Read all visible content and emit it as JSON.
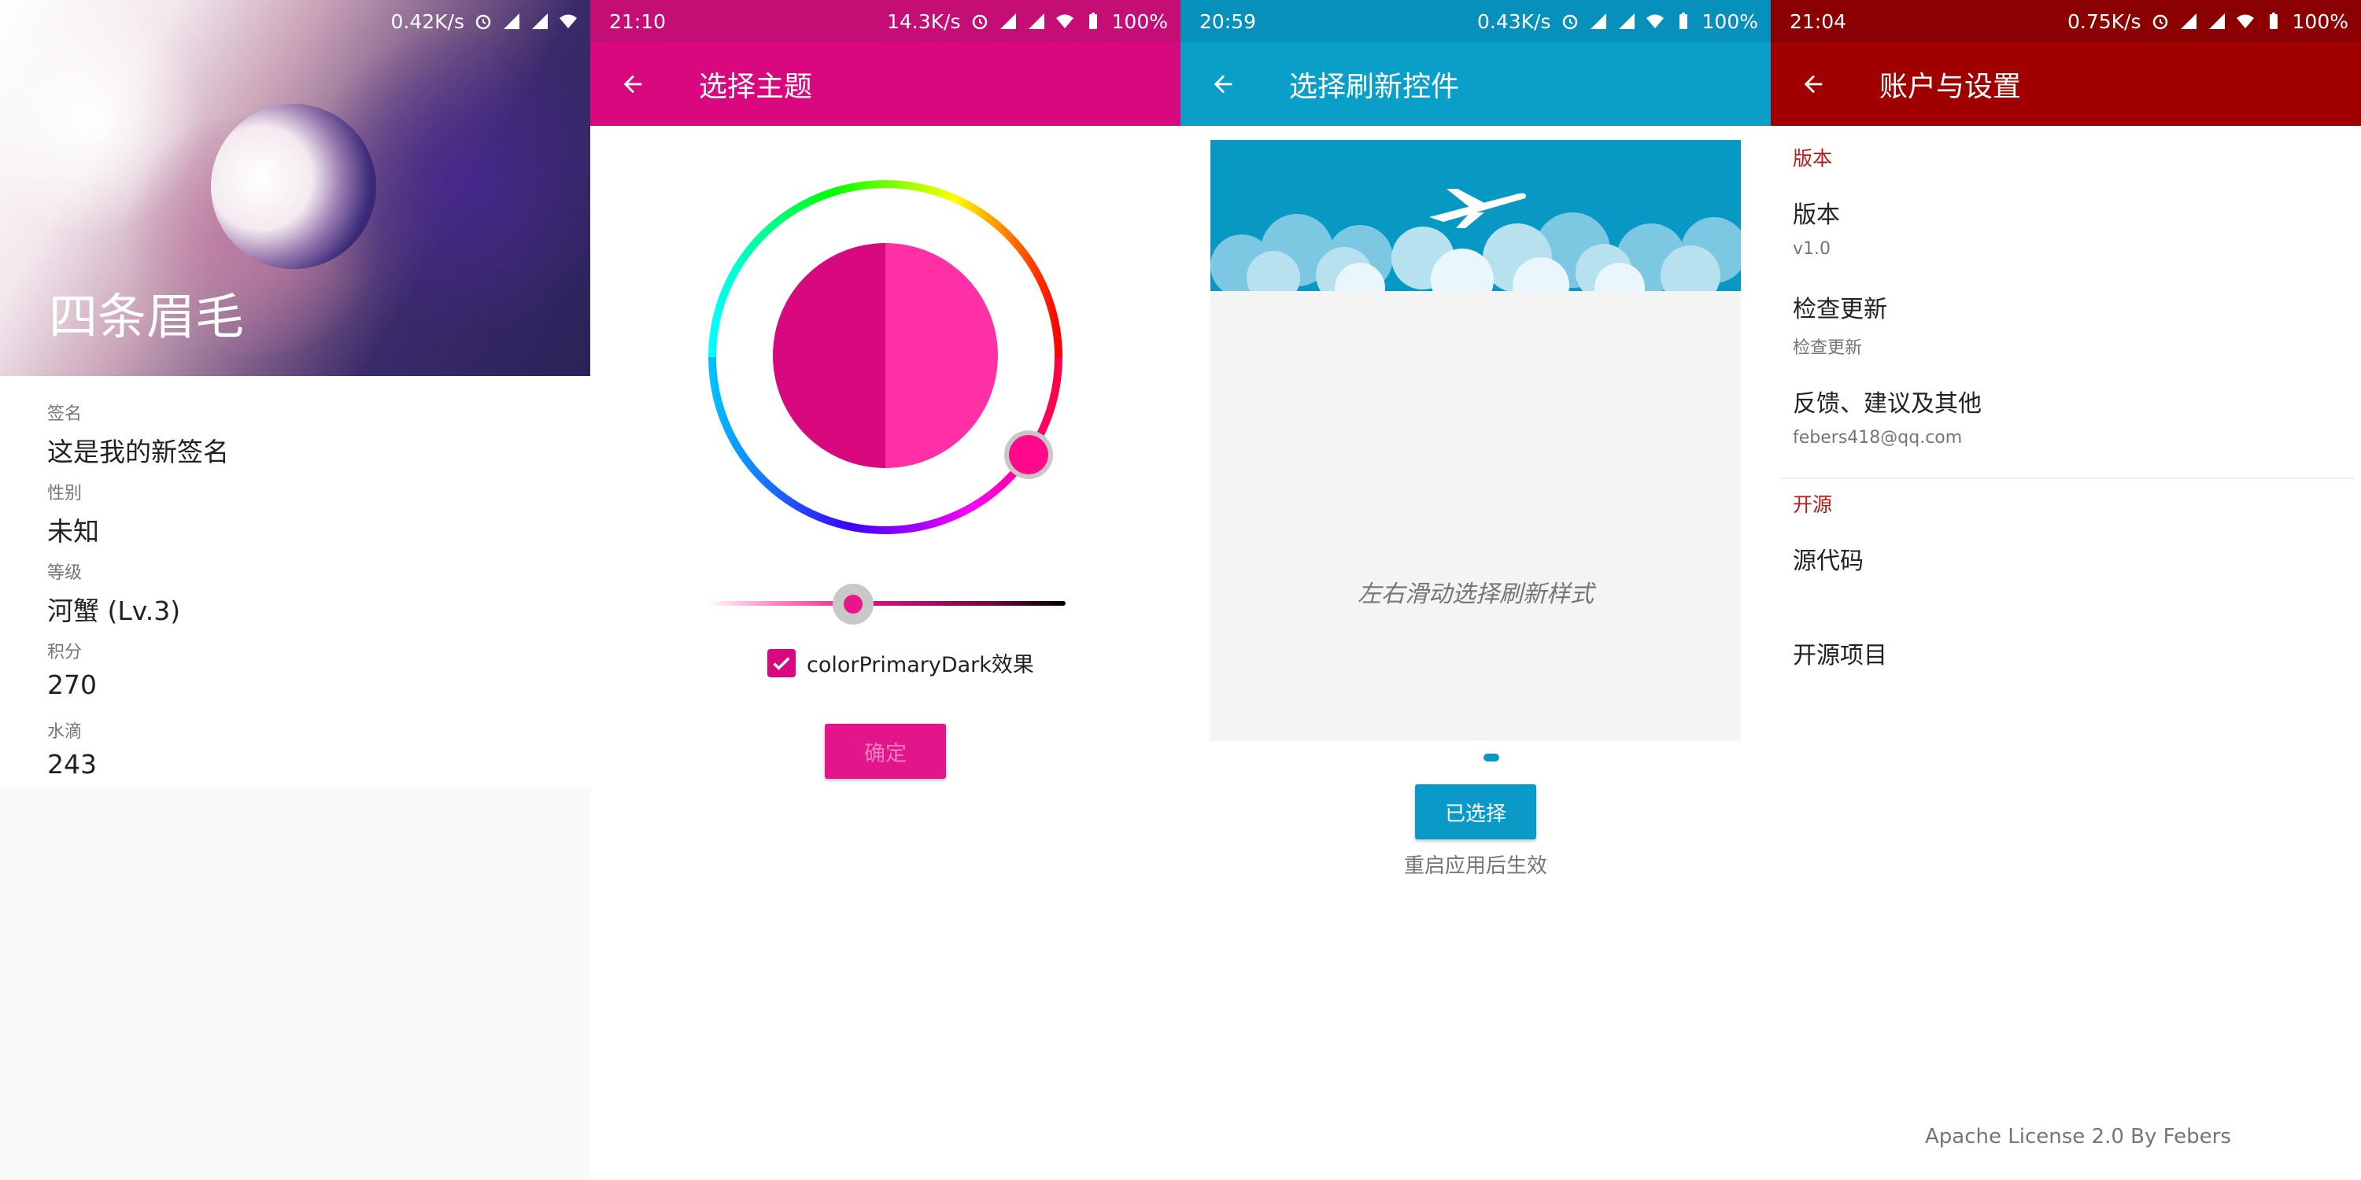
{
  "screen_profile": {
    "status": {
      "net_speed": "0.42K/s"
    },
    "nickname": "四条眉毛",
    "fields": [
      {
        "label": "签名",
        "value": "这是我的新签名"
      },
      {
        "label": "性别",
        "value": "未知"
      },
      {
        "label": "等级",
        "value": "河蟹 (Lv.3)"
      },
      {
        "label": "积分",
        "value": "270"
      },
      {
        "label": "水滴",
        "value": "243"
      }
    ]
  },
  "screen_theme": {
    "status": {
      "time": "21:10",
      "net_speed": "14.3K/s",
      "battery": "100%"
    },
    "title": "选择主题",
    "checkbox_label": "colorPrimaryDark效果",
    "confirm_label": "确定",
    "colors": {
      "primary": "#d8087e",
      "primary_dark": "#c40d75",
      "preview_light": "#ff2fa6"
    },
    "slider_value": 0.4,
    "checkbox_checked": true
  },
  "screen_refresh": {
    "status": {
      "time": "20:59",
      "net_speed": "0.43K/s",
      "battery": "100%"
    },
    "title": "选择刷新控件",
    "hint": "左右滑动选择刷新样式",
    "selected_label": "已选择",
    "note": "重启应用后生效",
    "colors": {
      "primary": "#099fc9"
    }
  },
  "screen_settings": {
    "status": {
      "time": "21:04",
      "net_speed": "0.75K/s",
      "battery": "100%"
    },
    "title": "账户与设置",
    "sections": [
      {
        "header": "版本",
        "items": [
          {
            "title": "版本",
            "summary": "v1.0"
          },
          {
            "title": "检查更新",
            "summary": "检查更新"
          },
          {
            "title": "反馈、建议及其他",
            "summary": "febers418@qq.com"
          }
        ]
      },
      {
        "header": "开源",
        "items": [
          {
            "title": "源代码"
          },
          {
            "title": "开源项目"
          }
        ]
      }
    ],
    "footer": "Apache License 2.0 By Febers",
    "colors": {
      "primary": "#a00000",
      "accent": "#b71c1c"
    }
  },
  "icons": [
    "back-arrow-icon",
    "signal-icon",
    "wifi-icon",
    "battery-icon",
    "alarm-icon",
    "check-icon",
    "airplane-icon"
  ]
}
